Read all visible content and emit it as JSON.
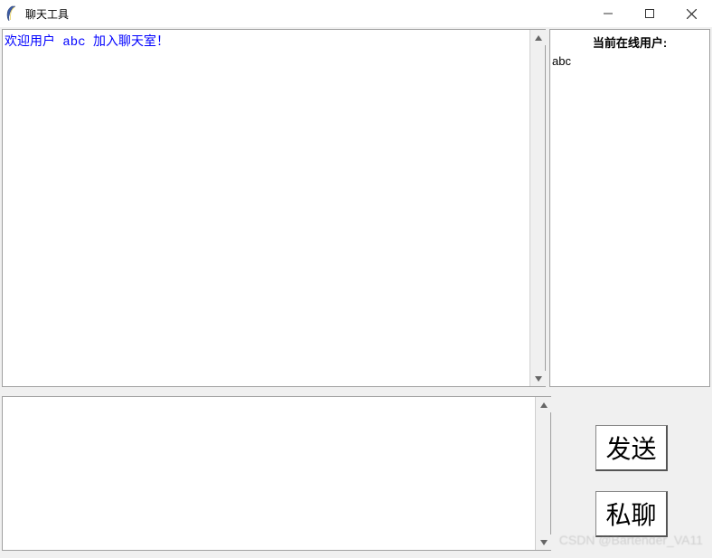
{
  "window": {
    "title": "聊天工具"
  },
  "chat": {
    "welcome_message": "欢迎用户 abc 加入聊天室！"
  },
  "users": {
    "header": "当前在线用户:",
    "list": [
      "abc"
    ]
  },
  "input": {
    "text": ""
  },
  "buttons": {
    "send": "发送",
    "private": "私聊"
  },
  "watermark": "CSDN @Bartender_VA11"
}
